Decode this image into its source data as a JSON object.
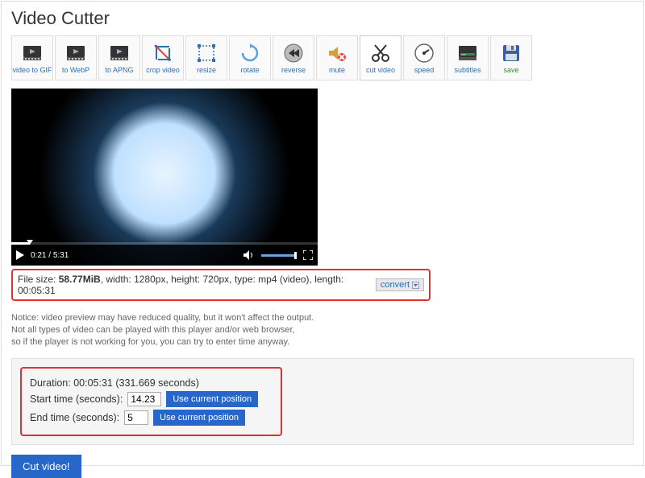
{
  "title": "Video Cutter",
  "toolbar": {
    "items": [
      {
        "label": "video to GIF",
        "icon": "film"
      },
      {
        "label": "to WebP",
        "icon": "film"
      },
      {
        "label": "to APNG",
        "icon": "film"
      },
      {
        "label": "crop video",
        "icon": "crop"
      },
      {
        "label": "resize",
        "icon": "resize"
      },
      {
        "label": "rotate",
        "icon": "rotate"
      },
      {
        "label": "reverse",
        "icon": "reverse"
      },
      {
        "label": "mute",
        "icon": "mute"
      },
      {
        "label": "cut video",
        "icon": "cut",
        "active": true
      },
      {
        "label": "speed",
        "icon": "speed"
      },
      {
        "label": "subtitles",
        "icon": "subtitles"
      },
      {
        "label": "save",
        "icon": "save",
        "cls": "save-tool"
      }
    ]
  },
  "player": {
    "current_time": "0:21",
    "total_time": "5:31"
  },
  "fileinfo": {
    "prefix": "File size: ",
    "size": "58.77MiB",
    "rest": ", width: 1280px, height: 720px, type: mp4 (video), length: 00:05:31",
    "convert_label": "convert"
  },
  "notice": {
    "l1": "Notice: video preview may have reduced quality, but it won't affect the output.",
    "l2": "Not all types of video can be played with this player and/or web browser,",
    "l3": "so if the player is not working for you, you can try to enter time anyway."
  },
  "timing": {
    "duration_label": "Duration: 00:05:31 (331.669 seconds)",
    "start_label": "Start time (seconds):",
    "start_value": "14.23",
    "end_label": "End time (seconds):",
    "end_value": "5",
    "use_pos_label": "Use current position"
  },
  "cut_button": "Cut video!"
}
